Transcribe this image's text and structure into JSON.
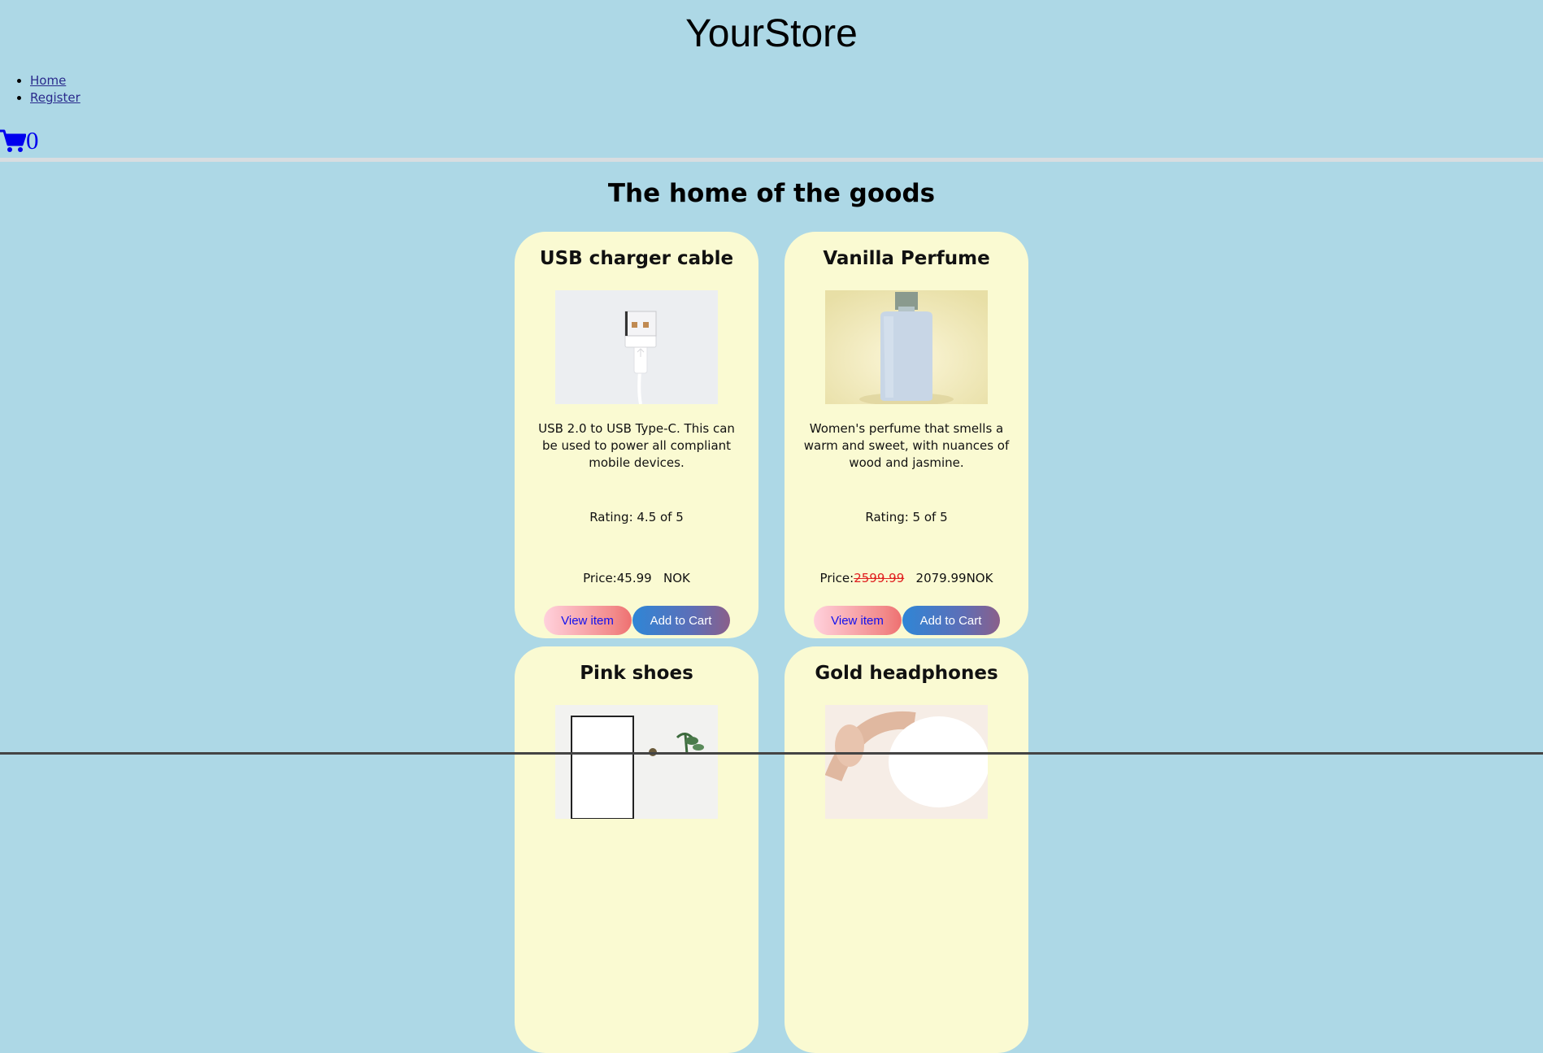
{
  "site_title": "YourStore",
  "nav": {
    "items": [
      {
        "label": "Home"
      },
      {
        "label": "Register"
      }
    ]
  },
  "cart": {
    "icon": "cart-icon",
    "count": "0",
    "color": "#0000ee"
  },
  "page_heading": "The home of the goods",
  "colors": {
    "page_background": "#add8e6",
    "card_background": "#fafad2",
    "old_price": "#e02020"
  },
  "products": [
    {
      "name": "USB charger cable",
      "description": "USB 2.0 to USB Type-C. This can be used to power all compliant mobile devices.",
      "rating_text": "Rating: 4.5 of 5",
      "price_label": "Price:",
      "old_price": "",
      "price": "45.99",
      "currency": "NOK",
      "view_label": "View item",
      "add_label": "Add to Cart"
    },
    {
      "name": "Vanilla Perfume",
      "description": "Women's perfume that smells a warm and sweet, with nuances of wood and jasmine.",
      "rating_text": "Rating: 5 of 5",
      "price_label": "Price:",
      "old_price": "2599.99",
      "price": "2079.99",
      "currency": "NOK",
      "view_label": "View item",
      "add_label": "Add to Cart"
    },
    {
      "name": "Pink shoes"
    },
    {
      "name": "Gold headphones"
    }
  ]
}
